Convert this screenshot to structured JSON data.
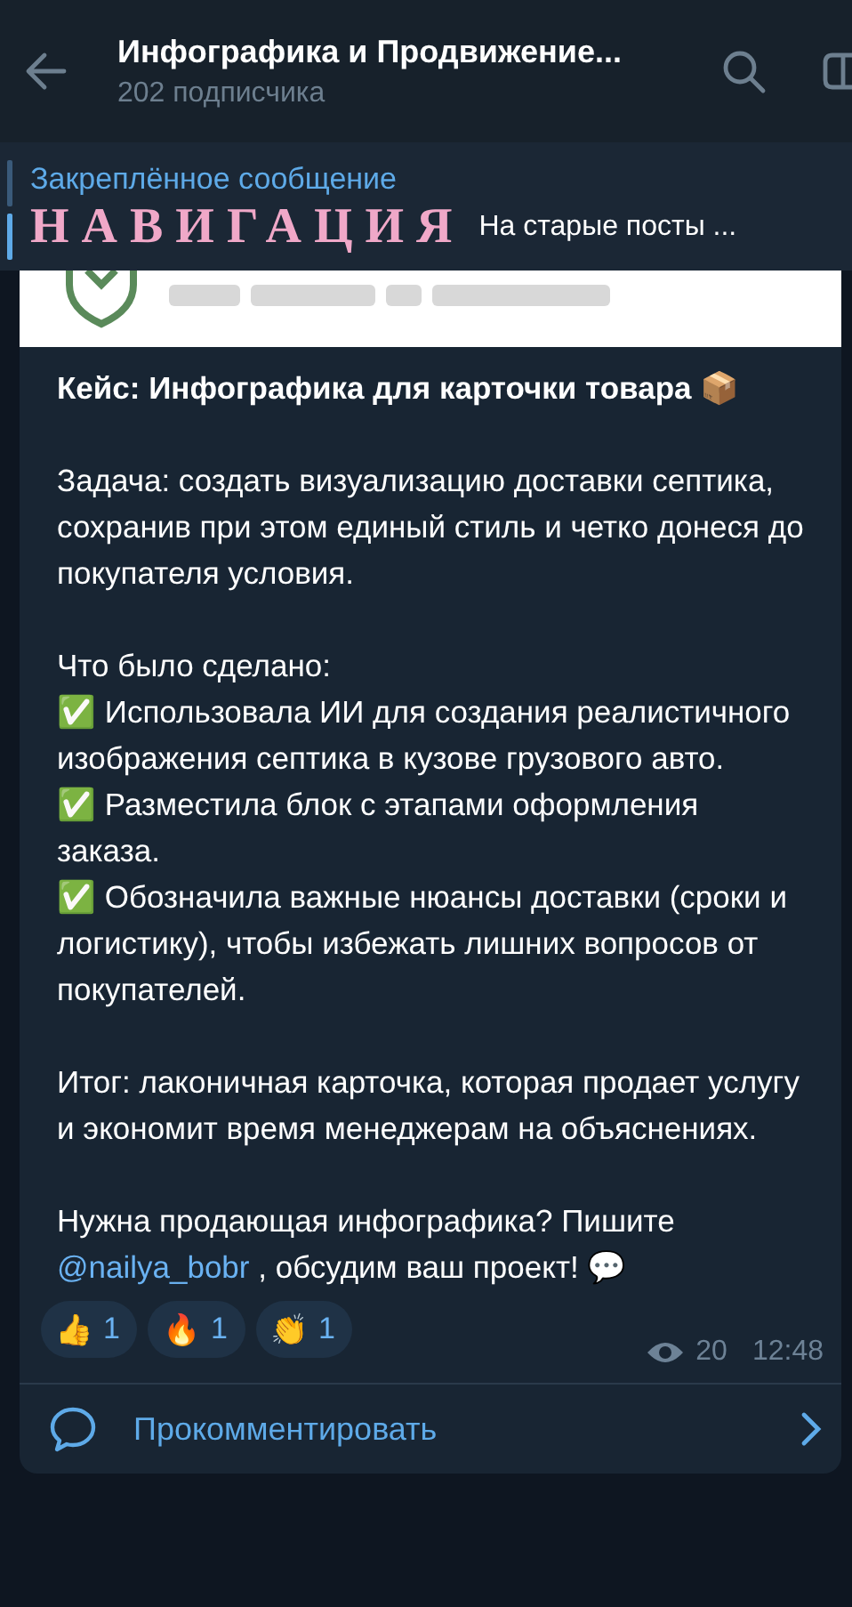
{
  "header": {
    "title": "Инфографика и Продвижение...",
    "subtitle": "202 подписчика"
  },
  "pinned": {
    "label": "Закреплённое сообщение",
    "heading": "НАВИГАЦИЯ",
    "preview": "На старые посты  ..."
  },
  "message": {
    "paragraphs": [
      {
        "kind": "title",
        "lines": [
          "Кейс: Инфографика для карточки товара 📦"
        ]
      },
      {
        "kind": "text",
        "lines": [
          "Задача: создать визуализацию доставки септика, сохранив при этом единый стиль и четко донеся до покупателя условия."
        ]
      },
      {
        "kind": "text",
        "lines": [
          "Что было сделано:",
          "✅ Использовала ИИ для создания реалистичного изображения септика в кузове грузового авто.",
          "✅ Разместила блок с этапами оформления заказа.",
          "✅ Обозначила важные нюансы доставки (сроки и логистику), чтобы избежать лишних вопросов от покупателей."
        ]
      },
      {
        "kind": "text",
        "lines": [
          "Итог: лаконичная карточка, которая продает услугу и экономит время менеджерам на объяснениях."
        ]
      },
      {
        "kind": "cta",
        "before": "Нужна продающая инфографика? Пишите ",
        "link": "@nailya_bobr",
        "after": " , обсудим ваш проект! 💬"
      }
    ],
    "reactions": [
      {
        "emoji": "👍",
        "count": "1"
      },
      {
        "emoji": "🔥",
        "count": "1"
      },
      {
        "emoji": "👏",
        "count": "1"
      }
    ],
    "views": "20",
    "time": "12:48"
  },
  "comment_button": {
    "label": "Прокомментировать"
  }
}
